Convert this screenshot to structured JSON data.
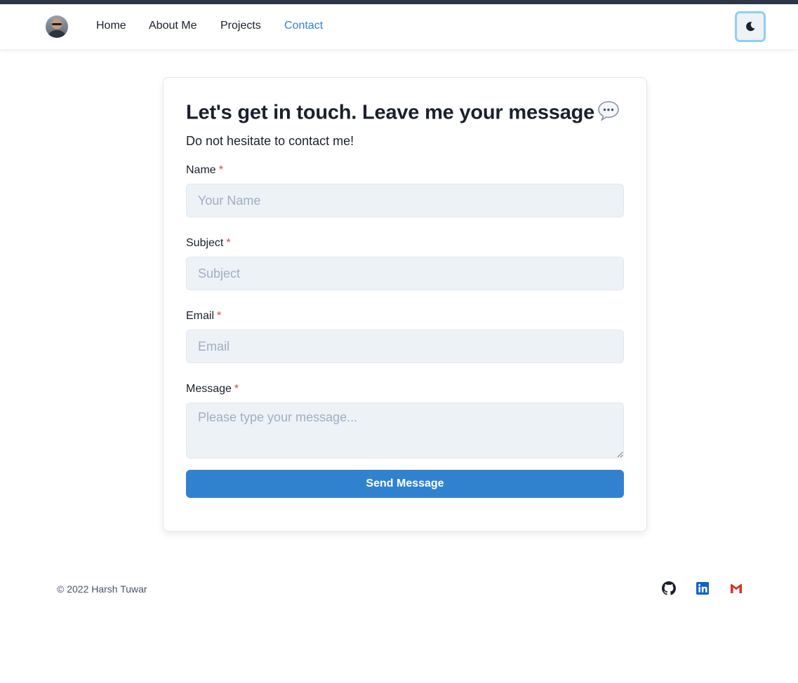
{
  "nav": {
    "links": [
      "Home",
      "About Me",
      "Projects",
      "Contact"
    ],
    "active": "Contact",
    "theme_icon": "moon-icon"
  },
  "form": {
    "title": "Let's get in touch. Leave me your message",
    "title_icon": "speech-bubble-icon",
    "subtitle": "Do not hesitate to contact me!",
    "required_mark": "*",
    "fields": {
      "name": {
        "label": "Name",
        "placeholder": "Your Name",
        "value": ""
      },
      "subject": {
        "label": "Subject",
        "placeholder": "Subject",
        "value": ""
      },
      "email": {
        "label": "Email",
        "placeholder": "Email",
        "value": ""
      },
      "message": {
        "label": "Message",
        "placeholder": "Please type your message...",
        "value": ""
      }
    },
    "submit_label": "Send Message"
  },
  "footer": {
    "copyright": "© 2022 Harsh Tuwar",
    "social": [
      "github-icon",
      "linkedin-icon",
      "gmail-icon"
    ]
  },
  "colors": {
    "accent": "#3182ce",
    "required": "#e53e3e",
    "linkedin": "#0a66c2",
    "gmail": "#d93025"
  }
}
